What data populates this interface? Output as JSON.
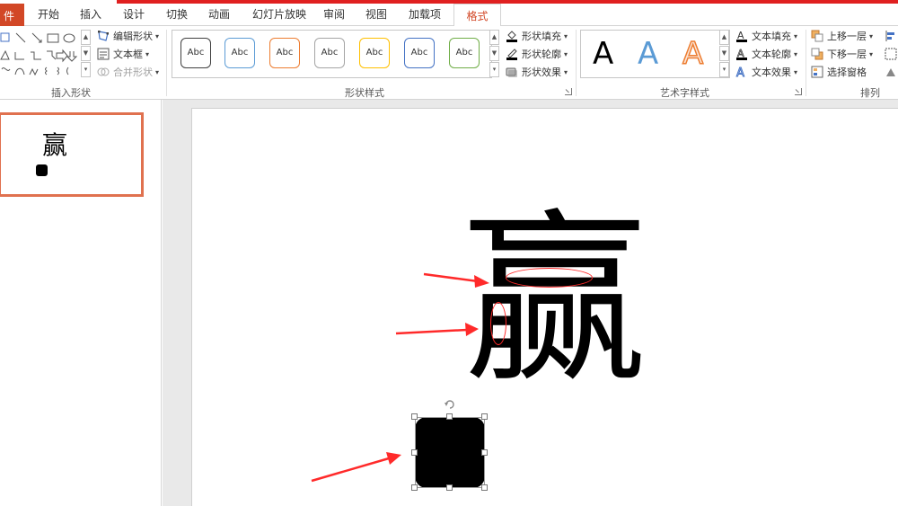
{
  "tabs": {
    "file": "件",
    "items": [
      "开始",
      "插入",
      "设计",
      "切换",
      "动画",
      "幻灯片放映",
      "审阅",
      "视图",
      "加载项"
    ],
    "active": "格式"
  },
  "ribbon": {
    "insert_shapes": {
      "label": "插入形状",
      "edit_shape": "编辑形状",
      "text_box": "文本框",
      "merge_shapes": "合并形状"
    },
    "shape_styles": {
      "label": "形状样式",
      "style_sample": "Abc",
      "style_colors": [
        "#404040",
        "#5b9bd5",
        "#ed7d31",
        "#a5a5a5",
        "#ffc000",
        "#4472c4",
        "#70ad47"
      ],
      "fill": "形状填充",
      "outline": "形状轮廓",
      "effects": "形状效果"
    },
    "wordart_styles": {
      "label": "艺术字样式",
      "sample": "A",
      "text_fill": "文本填充",
      "text_outline": "文本轮廓",
      "text_effects": "文本效果"
    },
    "arrange": {
      "label": "排列",
      "bring_forward": "上移一层",
      "send_backward": "下移一层",
      "selection_pane": "选择窗格"
    }
  },
  "thumbnail": {
    "char": "赢"
  },
  "slide": {
    "char": "赢"
  },
  "colors": {
    "accent_tab": "#d24726",
    "top_bar": "#e02020",
    "annotation": "#ff2a2a",
    "thumb_border": "#e0714f"
  }
}
